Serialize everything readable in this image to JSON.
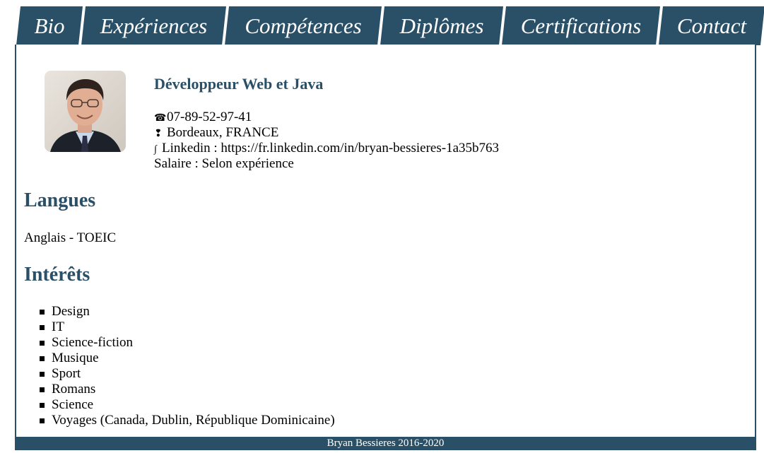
{
  "nav": {
    "tabs": [
      {
        "label": "Bio"
      },
      {
        "label": "Expériences"
      },
      {
        "label": "Compétences"
      },
      {
        "label": "Diplômes"
      },
      {
        "label": "Certifications"
      },
      {
        "label": "Contact"
      }
    ],
    "active_tab": "Bio"
  },
  "profile": {
    "photo_icon": "profile-photo",
    "title": "Développeur Web et Java",
    "phone_icon": "☎",
    "phone": "07-89-52-97-41",
    "location_icon": "❢",
    "location": "Bordeaux, FRANCE",
    "linkedin_icon": "∫",
    "linkedin": "Linkedin : https://fr.linkedin.com/in/bryan-bessieres-1a35b763",
    "salary": "Salaire : Selon expérience"
  },
  "languages": {
    "heading": "Langues",
    "text": "Anglais - TOEIC"
  },
  "interests": {
    "heading": "Intérêts",
    "items": [
      "Design",
      "IT",
      "Science-fiction",
      "Musique",
      "Sport",
      "Romans",
      "Science",
      "Voyages (Canada, Dublin, République Dominicaine)"
    ]
  },
  "footer": {
    "text": "Bryan Bessieres 2016-2020"
  },
  "colors": {
    "accent": "#2a5068",
    "background": "#ffffff"
  }
}
